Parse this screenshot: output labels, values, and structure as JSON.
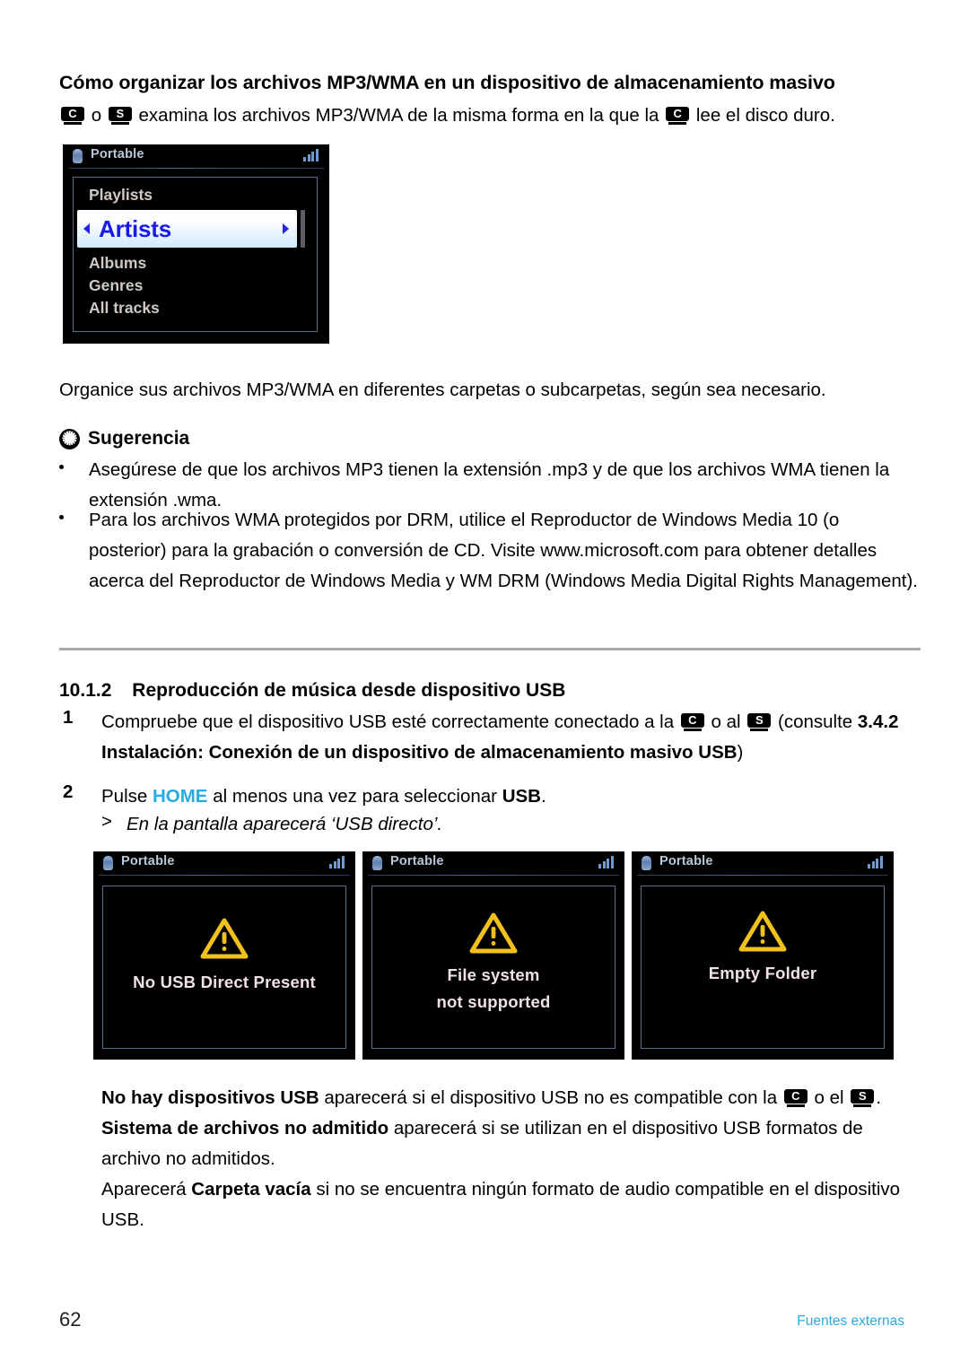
{
  "header": {
    "title": "Cómo organizar los archivos MP3/WMA en un dispositivo de almacenamiento masivo",
    "intro_a": "o",
    "intro_b": "examina los archivos MP3/WMA de la misma forma en la que la",
    "intro_c": "lee el disco duro."
  },
  "badges": {
    "c": "C",
    "s": "S"
  },
  "intro_paragraph": "Organice sus archivos MP3/WMA en diferentes carpetas o subcarpetas, según sea necesario.",
  "tip": {
    "icon": "asterisk-icon",
    "glyph": "✺",
    "label": "Sugerencia",
    "bullets": [
      "Asegúrese de que los archivos MP3 tienen la extensión .mp3 y de que los archivos WMA tienen la extensión .wma.",
      "Para los archivos WMA protegidos por DRM, utilice el Reproductor de Windows Media 10 (o posterior) para la grabación o conversión de CD. Visite www.microsoft.com para obtener detalles acerca del Reproductor de Windows Media y WM DRM (Windows Media Digital Rights Management)."
    ]
  },
  "section": {
    "number": "10.1.2",
    "title": "Reproducción de música desde dispositivo USB"
  },
  "steps": [
    {
      "num": "1",
      "text_a": "Compruebe que el dispositivo USB esté correctamente conectado a la",
      "text_b": "o al",
      "text_c": "(consulte",
      "ref_bold": "3.4.2 Instalación: Conexión de un dispositivo de almacenamiento masivo USB",
      "ref_tail": ")"
    },
    {
      "num": "2",
      "text_a": "Pulse",
      "key": "HOME",
      "text_b": "al menos una vez para seleccionar",
      "bold_tail": "USB",
      "period": ".",
      "result_marker": ">",
      "result": "En la pantalla aparecerá ‘USB directo’."
    }
  ],
  "screens": {
    "menu": {
      "header_title": "Portable",
      "header_icon": "portable-device-icon",
      "signal_icon": "signal-strength-icon",
      "items": [
        "Playlists",
        "Albums",
        "Genres",
        "All tracks"
      ],
      "selected": "Artists",
      "left_arrow_icon": "triangle-left-icon",
      "right_arrow_icon": "triangle-right-icon"
    },
    "warnings": [
      {
        "header_title": "Portable",
        "icon": "warning-triangle-icon",
        "lines": [
          "No USB Direct Present"
        ]
      },
      {
        "header_title": "Portable",
        "icon": "warning-triangle-icon",
        "lines": [
          "File system",
          "not supported"
        ]
      },
      {
        "header_title": "Portable",
        "icon": "warning-triangle-icon",
        "lines": [
          "Empty Folder"
        ]
      }
    ]
  },
  "notes": {
    "n1_bold": "No hay dispositivos USB",
    "n1_a": "aparecerá si el dispositivo USB no es compatible con la",
    "n1_b": "o el",
    "n1_c": ".",
    "n2_bold": "Sistema de archivos no admitido",
    "n2_text": "aparecerá si se utilizan en el dispositivo USB formatos de archivo no admitidos.",
    "n3_a": "Aparecerá",
    "n3_bold": "Carpeta vacía",
    "n3_b": "si no se encuentra ningún formato de audio compatible en el dispositivo USB."
  },
  "footer": {
    "page_number": "62",
    "section_label": "Fuentes externas"
  },
  "colors": {
    "accent_cyan": "#29aae3",
    "warning_yellow": "#f1c40f",
    "divider_gray": "#a6a8ab"
  }
}
